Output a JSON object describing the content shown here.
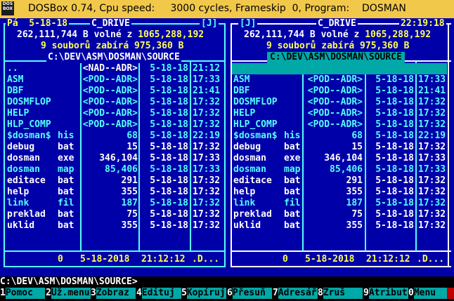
{
  "window": {
    "title": "DOSBox 0.74, Cpu speed:     3000 cycles, Frameskip  0, Program:    DOSMAN",
    "icon": "DOS BOX"
  },
  "left_panel": {
    "header_left": "Pá  5-18-18",
    "drive": "C_DRIVE",
    "header_right": "[J]",
    "free_line_prefix": "262,111,744 B volné z ",
    "free_total": "1065,288,192",
    "files_line": "9 souborů zabírá 975,360 B",
    "path": "C:\\DEV\\ASM\\DOSMAN\\SOURCE",
    "footer_count": "0",
    "footer_date": "5-18-2018",
    "footer_time": "21:12:12",
    "footer_name": ".D..."
  },
  "right_panel": {
    "header_left": "[J]",
    "drive": "C_DRIVE",
    "header_right": "22:19:18",
    "free_line_prefix": "262,111,744 B volné z ",
    "free_total": "1065,288,192",
    "files_line": "9 souborů zabírá 975,360 B",
    "path": "C:\\DEV\\ASM\\DOSMAN\\SOURCE",
    "footer_count": "0",
    "footer_date": "5-18-2018",
    "footer_time": "21:12:12",
    "footer_name": ".D..."
  },
  "files": [
    {
      "name": "..",
      "ext": "",
      "size": "<NAD--ADR>",
      "date": "5-18-18",
      "time": "21:12",
      "color": "cy"
    },
    {
      "name": "ASM",
      "ext": "",
      "size": "<POD--ADR>",
      "date": "5-18-18",
      "time": "17:33",
      "color": "cy"
    },
    {
      "name": "DBF",
      "ext": "",
      "size": "<POD--ADR>",
      "date": "5-18-18",
      "time": "21:41",
      "color": "cy"
    },
    {
      "name": "DOSMFLOP",
      "ext": "",
      "size": "<POD--ADR>",
      "date": "5-18-18",
      "time": "17:32",
      "color": "cy"
    },
    {
      "name": "HELP",
      "ext": "",
      "size": "<POD--ADR>",
      "date": "5-18-18",
      "time": "17:32",
      "color": "cy"
    },
    {
      "name": "HLP_COMP",
      "ext": "",
      "size": "<POD--ADR>",
      "date": "5-18-18",
      "time": "17:32",
      "color": "cy"
    },
    {
      "name": "$dosman$",
      "ext": "his",
      "size": "68",
      "date": "5-18-18",
      "time": "22:19",
      "color": "cy"
    },
    {
      "name": "debug",
      "ext": "bat",
      "size": "15",
      "date": "5-18-18",
      "time": "17:32",
      "color": "wh"
    },
    {
      "name": "dosman",
      "ext": "exe",
      "size": "346,104",
      "date": "5-18-18",
      "time": "17:33",
      "color": "wh"
    },
    {
      "name": "dosman",
      "ext": "map",
      "size": "85,406",
      "date": "5-18-18",
      "time": "17:33",
      "color": "cy"
    },
    {
      "name": "editace",
      "ext": "bat",
      "size": "291",
      "date": "5-18-18",
      "time": "17:32",
      "color": "wh"
    },
    {
      "name": "help",
      "ext": "bat",
      "size": "355",
      "date": "5-18-18",
      "time": "17:32",
      "color": "wh"
    },
    {
      "name": "link",
      "ext": "fil",
      "size": "187",
      "date": "5-18-18",
      "time": "17:32",
      "color": "cy"
    },
    {
      "name": "preklad",
      "ext": "bat",
      "size": "75",
      "date": "5-18-18",
      "time": "17:32",
      "color": "wh"
    },
    {
      "name": "uklid",
      "ext": "bat",
      "size": "355",
      "date": "5-18-18",
      "time": "17:32",
      "color": "wh"
    }
  ],
  "command_line": "C:\\DEV\\ASM\\DOSMAN\\SOURCE>",
  "function_keys": [
    {
      "num": "1",
      "label": "Pomoc"
    },
    {
      "num": "2",
      "label": "Už.menu"
    },
    {
      "num": "3",
      "label": "Zobraz"
    },
    {
      "num": "4",
      "label": "Edituj"
    },
    {
      "num": "5",
      "label": "Kopíruj"
    },
    {
      "num": "6",
      "label": "Přesuň"
    },
    {
      "num": "7",
      "label": "Adresář"
    },
    {
      "num": "8",
      "label": "Zruš"
    },
    {
      "num": "9",
      "label": "Atribut"
    },
    {
      "num": "0",
      "label": "Menu"
    }
  ],
  "colors": {
    "background": "#0000a8",
    "frame": "#55ffff",
    "highlight": "#ffff55",
    "selection": "#00a8a8",
    "titlebar": "#f2c84b"
  }
}
